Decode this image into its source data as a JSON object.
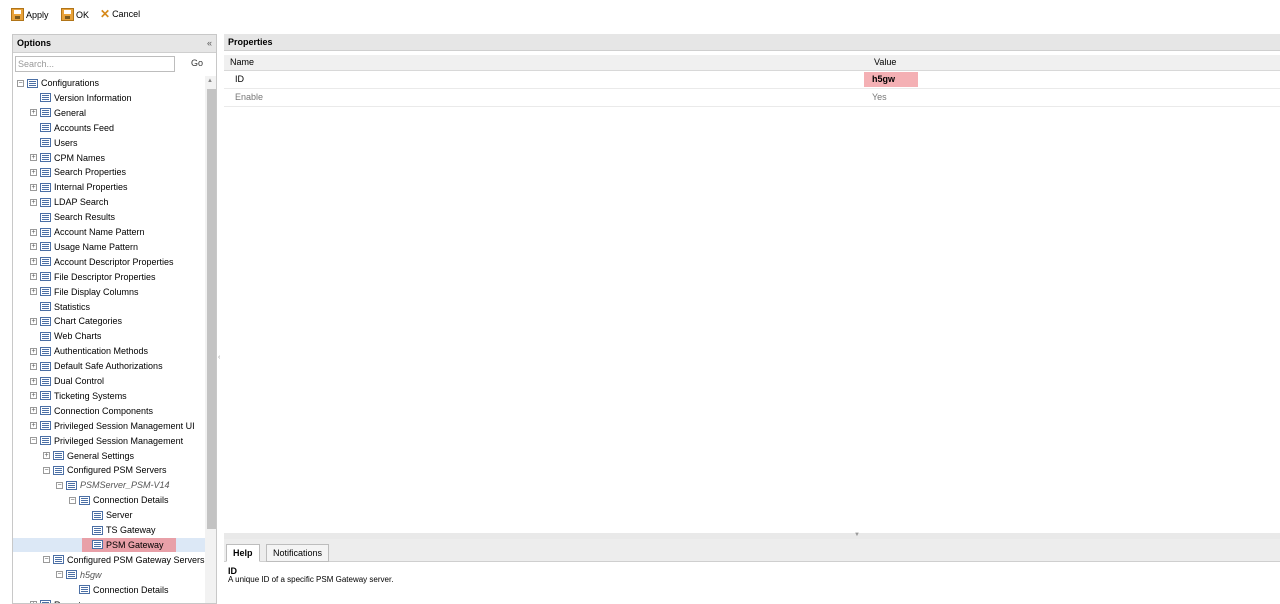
{
  "toolbar": {
    "apply": "Apply",
    "ok": "OK",
    "cancel": "Cancel"
  },
  "options": {
    "title": "Options",
    "collapse": "«",
    "search_placeholder": "Search...",
    "go": "Go"
  },
  "tree": [
    {
      "label": "Configurations",
      "depth": 0,
      "exp": "-"
    },
    {
      "label": "Version Information",
      "depth": 1,
      "exp": ""
    },
    {
      "label": "General",
      "depth": 1,
      "exp": "+"
    },
    {
      "label": "Accounts Feed",
      "depth": 1,
      "exp": ""
    },
    {
      "label": "Users",
      "depth": 1,
      "exp": ""
    },
    {
      "label": "CPM Names",
      "depth": 1,
      "exp": "+"
    },
    {
      "label": "Search Properties",
      "depth": 1,
      "exp": "+"
    },
    {
      "label": "Internal Properties",
      "depth": 1,
      "exp": "+"
    },
    {
      "label": "LDAP Search",
      "depth": 1,
      "exp": "+"
    },
    {
      "label": "Search Results",
      "depth": 1,
      "exp": ""
    },
    {
      "label": "Account Name Pattern",
      "depth": 1,
      "exp": "+"
    },
    {
      "label": "Usage Name Pattern",
      "depth": 1,
      "exp": "+"
    },
    {
      "label": "Account Descriptor Properties",
      "depth": 1,
      "exp": "+"
    },
    {
      "label": "File Descriptor Properties",
      "depth": 1,
      "exp": "+"
    },
    {
      "label": "File Display Columns",
      "depth": 1,
      "exp": "+"
    },
    {
      "label": "Statistics",
      "depth": 1,
      "exp": ""
    },
    {
      "label": "Chart Categories",
      "depth": 1,
      "exp": "+"
    },
    {
      "label": "Web Charts",
      "depth": 1,
      "exp": ""
    },
    {
      "label": "Authentication Methods",
      "depth": 1,
      "exp": "+"
    },
    {
      "label": "Default Safe Authorizations",
      "depth": 1,
      "exp": "+"
    },
    {
      "label": "Dual Control",
      "depth": 1,
      "exp": "+"
    },
    {
      "label": "Ticketing Systems",
      "depth": 1,
      "exp": "+"
    },
    {
      "label": "Connection Components",
      "depth": 1,
      "exp": "+"
    },
    {
      "label": "Privileged Session Management UI",
      "depth": 1,
      "exp": "+"
    },
    {
      "label": "Privileged Session Management",
      "depth": 1,
      "exp": "-"
    },
    {
      "label": "General Settings",
      "depth": 2,
      "exp": "+"
    },
    {
      "label": "Configured PSM Servers",
      "depth": 2,
      "exp": "-"
    },
    {
      "label": "PSMServer_PSM-V14",
      "depth": 3,
      "exp": "-",
      "italic": true
    },
    {
      "label": "Connection Details",
      "depth": 4,
      "exp": "-"
    },
    {
      "label": "Server",
      "depth": 5,
      "exp": ""
    },
    {
      "label": "TS Gateway",
      "depth": 5,
      "exp": ""
    },
    {
      "label": "PSM Gateway",
      "depth": 5,
      "exp": "",
      "selected": true
    },
    {
      "label": "Configured PSM Gateway Servers",
      "depth": 2,
      "exp": "-"
    },
    {
      "label": "h5gw",
      "depth": 3,
      "exp": "-",
      "italic": true
    },
    {
      "label": "Connection Details",
      "depth": 4,
      "exp": ""
    },
    {
      "label": "Reports",
      "depth": 1,
      "exp": "+"
    }
  ],
  "properties": {
    "title": "Properties",
    "col_name": "Name",
    "col_value": "Value",
    "rows": [
      {
        "name": "ID",
        "value": "h5gw"
      },
      {
        "name": "Enable",
        "value": "Yes"
      }
    ]
  },
  "bottom": {
    "tab_help": "Help",
    "tab_notifications": "Notifications",
    "help_title": "ID",
    "help_text": "A unique ID of a specific PSM Gateway server."
  }
}
